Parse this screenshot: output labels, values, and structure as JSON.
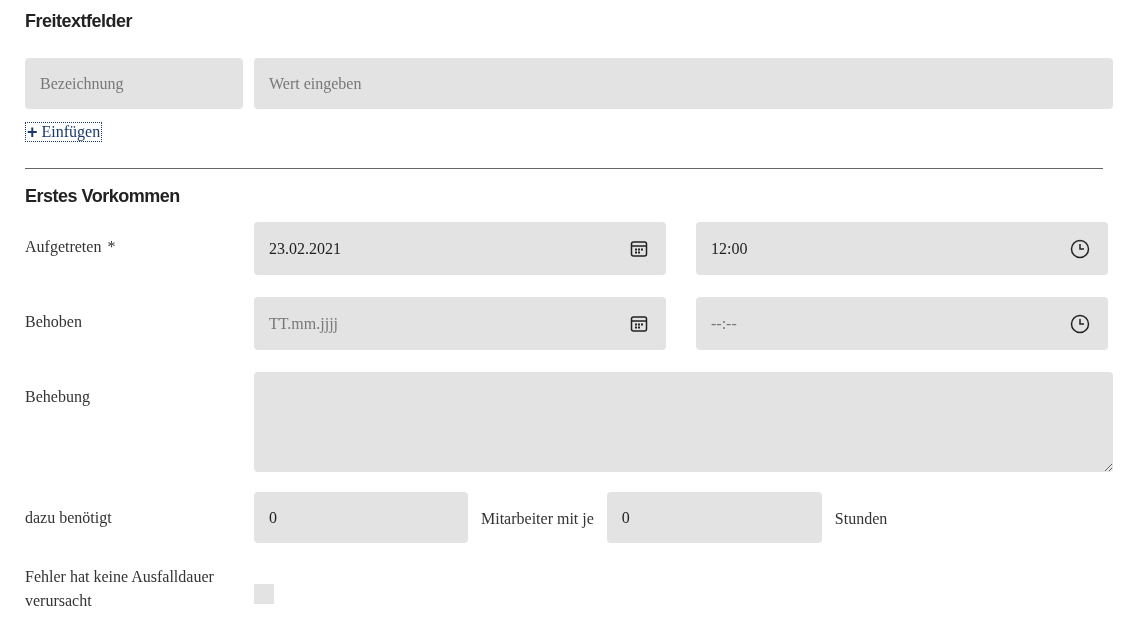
{
  "freetext": {
    "heading": "Freitextfelder",
    "label_field": {
      "placeholder": "Bezeichnung"
    },
    "value_field": {
      "placeholder": "Wert eingeben"
    },
    "add_link": {
      "icon": "+",
      "label": "Einfügen"
    }
  },
  "occurrence": {
    "heading": "Erstes Vorkommen",
    "rows": [
      {
        "kind": "datetime",
        "label": "Aufgetreten",
        "required_mark": "*",
        "date": {
          "value": "23.02.2021"
        },
        "time": {
          "value": "12:00"
        }
      },
      {
        "kind": "datetime",
        "label": "Behoben",
        "date": {
          "placeholder": "TT.mm.jjjj"
        },
        "time": {
          "placeholder": "--:--"
        }
      },
      {
        "kind": "textarea",
        "label": "Behebung"
      },
      {
        "kind": "effort",
        "label": "dazu benötigt",
        "workers": {
          "value": "0"
        },
        "middle": "Mitarbeiter mit je",
        "hours": {
          "value": "0"
        },
        "unit": "Stunden"
      },
      {
        "kind": "checkbox",
        "label": "Fehler hat keine Ausfalldauer verursacht",
        "checked": false
      }
    ]
  }
}
